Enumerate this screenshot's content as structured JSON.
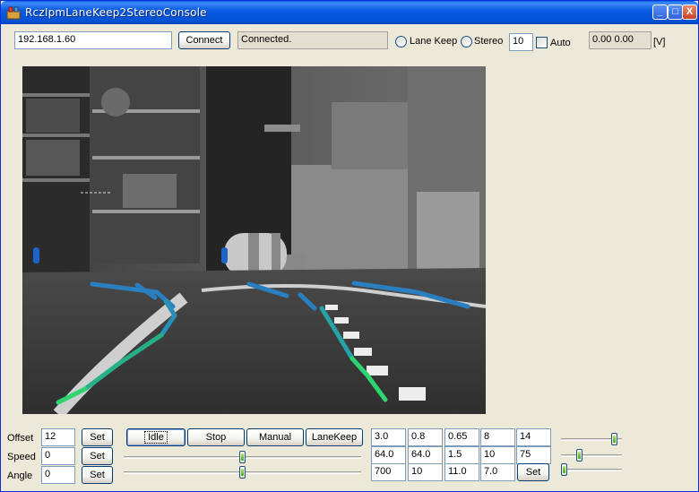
{
  "window": {
    "title": "RczIpmLaneKeep2StereoConsole",
    "minimize": "_",
    "maximize": "□",
    "close": "X"
  },
  "toolbar": {
    "ip_value": "192.168.1.60",
    "connect_label": "Connect",
    "status_text": "Connected.",
    "lane_keep_label": "Lane Keep",
    "stereo_label": "Stereo",
    "frame_value": "10",
    "auto_label": "Auto",
    "voltage_readout": "0.00  0.00",
    "voltage_unit": "[V]"
  },
  "controls": {
    "offset": {
      "label": "Offset",
      "value": "12",
      "set_label": "Set"
    },
    "speed": {
      "label": "Speed",
      "value": "0",
      "set_label": "Set"
    },
    "angle": {
      "label": "Angle",
      "value": "0",
      "set_label": "Set"
    }
  },
  "modes": {
    "idle": "Idle",
    "stop": "Stop",
    "manual": "Manual",
    "lanekeep": "LaneKeep"
  },
  "params": {
    "row1": [
      "3.0",
      "0.8",
      "0.65",
      "8",
      "14"
    ],
    "row2": [
      "64.0",
      "64.0",
      "1.5",
      "10",
      "75"
    ],
    "row3": [
      "700",
      "10",
      "11.0",
      "7.0"
    ],
    "set_label": "Set"
  },
  "sliders": {
    "speed_level": 0.5,
    "angle_level": 0.5,
    "param1_level": 0.92,
    "param2_level": 0.28,
    "param3_level": 0.0
  },
  "colors": {
    "title_bar": "#0a5be3",
    "lane_far": "#2a7fc0",
    "lane_near": "#2ed470",
    "marker": "#1e63c8"
  }
}
